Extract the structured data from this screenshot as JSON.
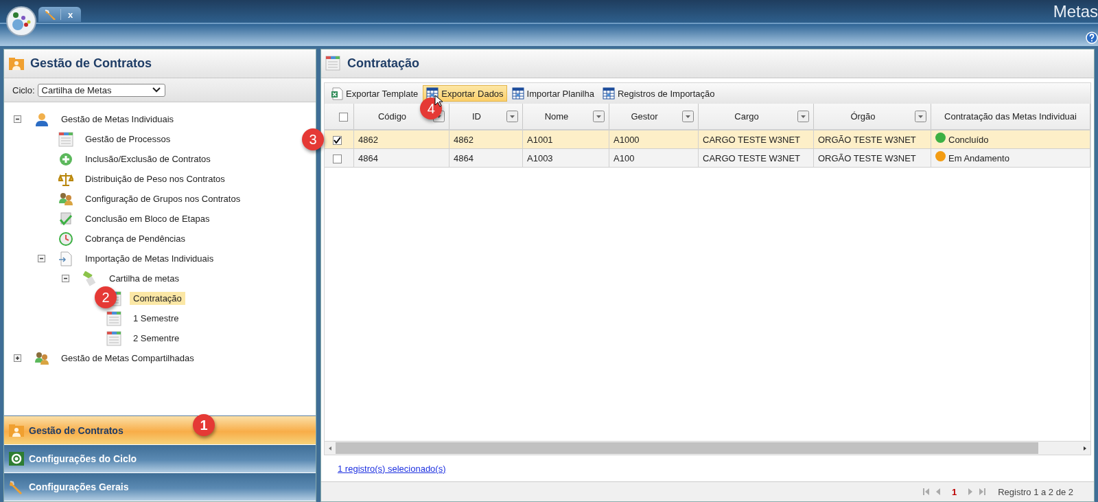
{
  "header": {
    "tab_close": "x",
    "title": "Metas"
  },
  "left_panel": {
    "title": "Gestão de Contratos",
    "cycle": {
      "label": "Ciclo:",
      "value": "Cartilha de Metas"
    },
    "tree": [
      {
        "label": "Gestão de Metas Individuais",
        "kind": "person",
        "expanded": true,
        "selected": false,
        "children": [
          {
            "label": "Gestão de Processos",
            "kind": "sheet",
            "selected": false
          },
          {
            "label": "Inclusão/Exclusão de Contratos",
            "kind": "plus",
            "selected": false
          },
          {
            "label": "Distribuição de Peso nos Contratos",
            "kind": "scales",
            "selected": false
          },
          {
            "label": "Configuração de Grupos nos Contratos",
            "kind": "group",
            "selected": false
          },
          {
            "label": "Conclusão em Bloco de Etapas",
            "kind": "check",
            "selected": false
          },
          {
            "label": "Cobrança de Pendências",
            "kind": "clock",
            "selected": false
          },
          {
            "label": "Importação de Metas Individuais",
            "kind": "import",
            "expanded": true,
            "selected": false,
            "children": [
              {
                "label": "Cartilha de metas",
                "kind": "brush",
                "expanded": true,
                "selected": false,
                "children": [
                  {
                    "label": "Contratação",
                    "kind": "sheet",
                    "selected": true,
                    "badge": "2"
                  },
                  {
                    "label": "1 Semestre",
                    "kind": "sheet",
                    "selected": false
                  },
                  {
                    "label": "2 Sementre",
                    "kind": "sheet",
                    "selected": false
                  }
                ]
              }
            ]
          }
        ]
      },
      {
        "label": "Gestão de Metas Compartilhadas",
        "kind": "group",
        "expanded": false,
        "selected": false
      }
    ],
    "accordion": [
      {
        "label": "Gestão de Contratos",
        "kind": "folder",
        "selected": true,
        "badge": "1"
      },
      {
        "label": "Configurações do Ciclo",
        "kind": "cycle",
        "selected": false
      },
      {
        "label": "Configurações Gerais",
        "kind": "wrench",
        "selected": false
      }
    ]
  },
  "main": {
    "title": "Contratação",
    "toolbar": [
      {
        "label": "Exportar Template",
        "kind": "excel",
        "selected": false
      },
      {
        "label": "Exportar Dados",
        "kind": "grid",
        "selected": true,
        "badge": "4"
      },
      {
        "label": "Importar Planilha",
        "kind": "grid",
        "selected": false
      },
      {
        "label": "Registros de Importação",
        "kind": "grid",
        "selected": false
      }
    ],
    "table": {
      "all_checked": false,
      "columns": [
        {
          "label": "Código",
          "filter": true
        },
        {
          "label": "ID",
          "filter": true
        },
        {
          "label": "Nome",
          "filter": true
        },
        {
          "label": "Gestor",
          "filter": true
        },
        {
          "label": "Cargo",
          "filter": true
        },
        {
          "label": "Órgão",
          "filter": true
        },
        {
          "label": "Contratação das Metas Individuai",
          "filter": false
        }
      ],
      "rows": [
        {
          "selected": true,
          "badge": "3",
          "cells": [
            "4862",
            "4862",
            "A1001",
            "A1000",
            "CARGO TESTE W3NET",
            "ORGÃO TESTE W3NET"
          ],
          "status": {
            "label": "Concluído",
            "color": "#3cb043"
          }
        },
        {
          "selected": false,
          "cells": [
            "4864",
            "4864",
            "A1003",
            "A100",
            "CARGO TESTE W3NET",
            "ORGÃO TESTE W3NET"
          ],
          "status": {
            "label": "Em Andamento",
            "color": "#f39c12"
          }
        }
      ]
    },
    "selection_link": "1 registro(s) selecionado(s)",
    "pager": {
      "page": "1",
      "summary": "Registro 1 a 2 de 2"
    }
  }
}
